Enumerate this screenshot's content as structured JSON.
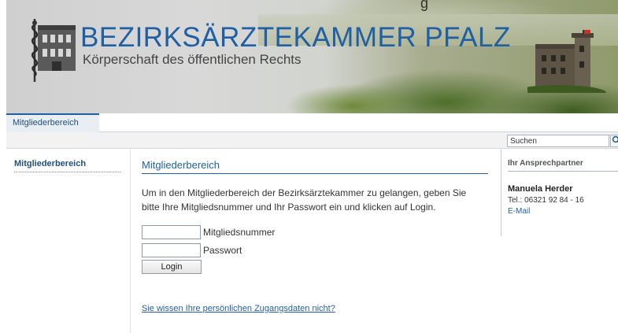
{
  "header": {
    "title": "BEZIRKSÄRZTEKAMMER PFALZ",
    "subtitle": "Körperschaft des öffentlichen Rechts",
    "logo_icon": "caduceus-building-logo-icon",
    "castle_icon": "castle-image-icon",
    "top_fragment": "g"
  },
  "nav": {
    "tabs": [
      {
        "label": "Mitgliederbereich",
        "active": true
      }
    ]
  },
  "search": {
    "value": "Suchen",
    "icon": "magnifier-icon"
  },
  "sidebar": {
    "items": [
      {
        "label": "Mitgliederbereich"
      }
    ]
  },
  "main": {
    "title": "Mitgliederbereich",
    "intro": "Um in den Mitgliederbereich der Bezirksärztekammer zu gelangen, geben Sie bitte Ihre Mitgliedsnummer und Ihr Passwort ein und klicken auf Login.",
    "fields": {
      "member_number_label": "Mitgliedsnummer",
      "password_label": "Passwort"
    },
    "login_label": "Login",
    "forgot_link": "Sie wissen Ihre persönlichen Zugangsdaten nicht?"
  },
  "contact": {
    "heading": "Ihr Ansprechpartner",
    "name": "Manuela Herder",
    "tel": "Tel.: 06321 92 84 - 16",
    "email_label": "E-Mail"
  },
  "colors": {
    "brand_blue": "#1f5fa3",
    "link_blue": "#1f4f82"
  }
}
